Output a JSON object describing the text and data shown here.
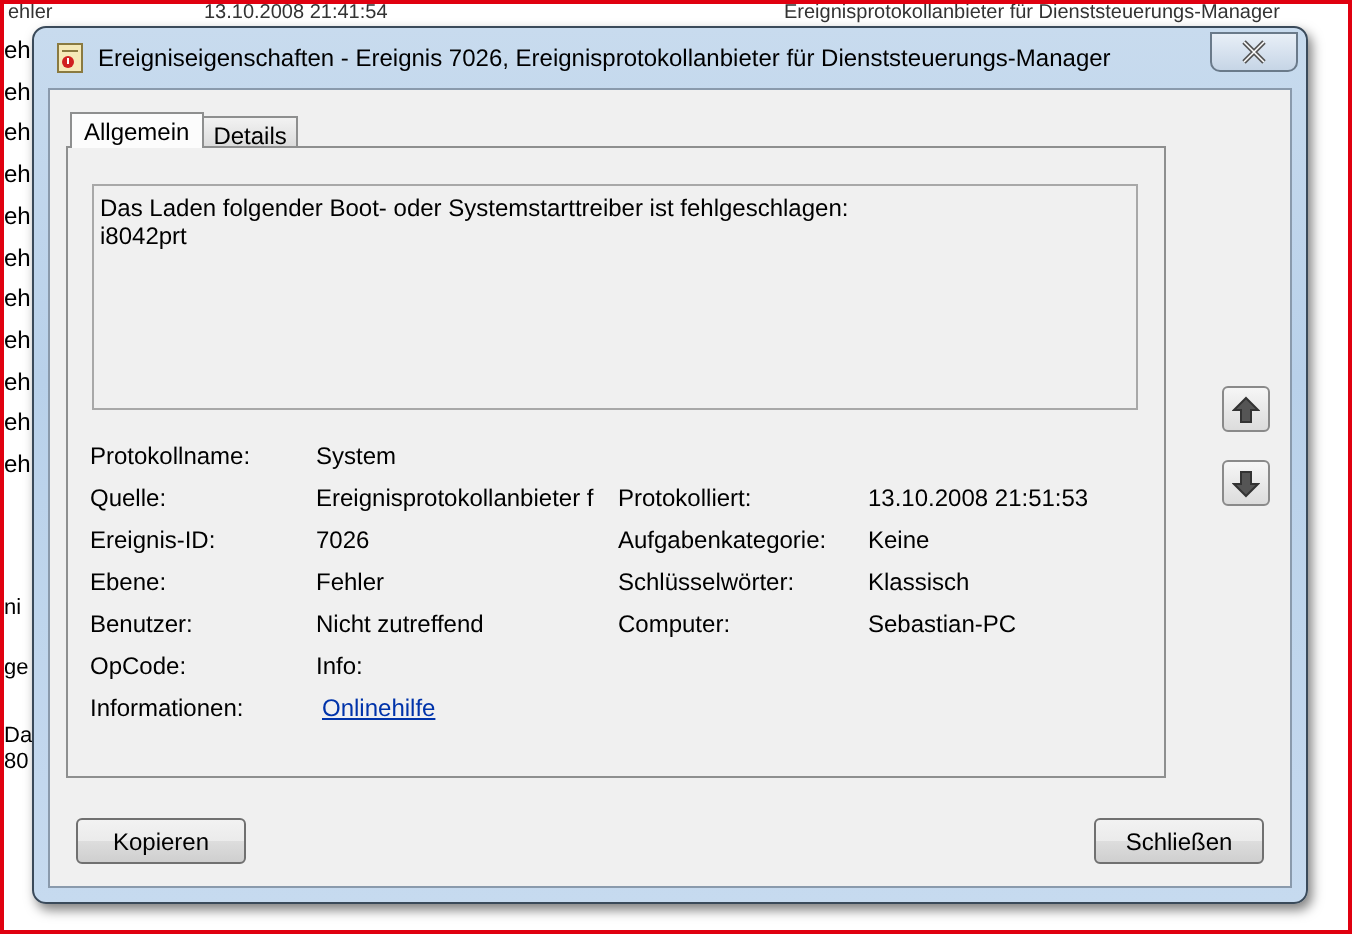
{
  "background_window": {
    "top_row": [
      "ehler",
      "13.10.2008 21:41:54",
      "Ereignisprotokollanbieter für Dienststeuerungs-Manager"
    ],
    "left_fragments": [
      "eh",
      "eh",
      "eh",
      "eh",
      "eh",
      "eh",
      "eh",
      "eh",
      "eh",
      "eh",
      "eh"
    ],
    "lower_fragments": [
      "ni",
      "ge",
      "Da",
      "80"
    ]
  },
  "window": {
    "title": "Ereigniseigenschaften - Ereignis 7026, Ereignisprotokollanbieter für Dienststeuerungs-Manager",
    "tabs": [
      {
        "label": "Allgemein",
        "selected": true
      },
      {
        "label": "Details",
        "selected": false
      }
    ],
    "message": [
      "Das Laden folgender Boot- oder Systemstarttreiber ist fehlgeschlagen:",
      "i8042prt"
    ],
    "rows": [
      {
        "label": "Protokollname:",
        "value": "System",
        "kind": "text"
      },
      {
        "label": "Quelle:",
        "value": "Ereignisprotokollanbieter f",
        "kind": "text",
        "second": {
          "label": "Protokolliert:",
          "value": "13.10.2008 21:51:53"
        }
      },
      {
        "label": "Ereignis-ID:",
        "value": "7026",
        "kind": "text",
        "second": {
          "label": "Aufgabenkategorie:",
          "value": "Keine"
        }
      },
      {
        "label": "Ebene:",
        "value": "Fehler",
        "kind": "text",
        "second": {
          "label": "Schlüsselwörter:",
          "value": "Klassisch"
        }
      },
      {
        "label": "Benutzer:",
        "value": "Nicht zutreffend",
        "kind": "text",
        "second": {
          "label": "Computer:",
          "value": "Sebastian-PC"
        }
      },
      {
        "label": "OpCode:",
        "value": "Info:",
        "kind": "text"
      },
      {
        "label": "Informationen:",
        "value": "Onlinehilfe",
        "kind": "link"
      }
    ],
    "buttons": [
      "Kopieren",
      "Schließen"
    ]
  }
}
